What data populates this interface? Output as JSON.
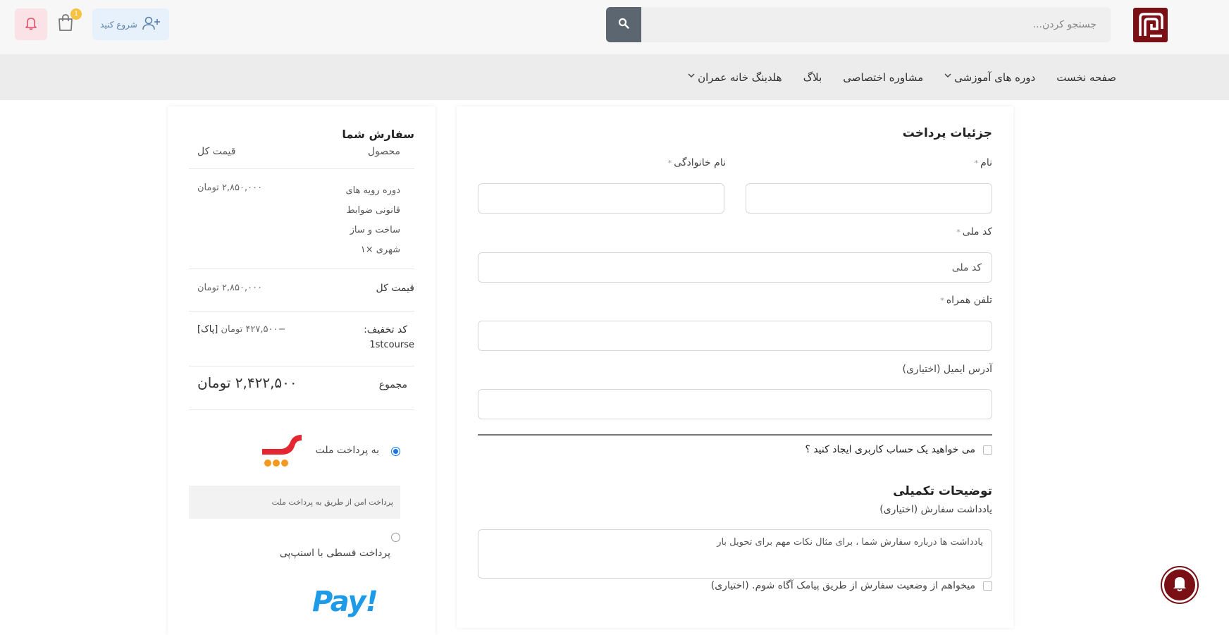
{
  "header": {
    "logo_icon": "brand-logo-icon",
    "search_placeholder": "جستجو کردن...",
    "login_label": "شروع کنید",
    "cart_count": "1",
    "colors": {
      "brand": "#7a1016",
      "search_button": "#5c6670",
      "login_bg": "#e6f1fb",
      "bell_bg": "#fbe2e6",
      "badge": "#f5c242"
    }
  },
  "nav": {
    "items": [
      {
        "label": "صفحه نخست",
        "dropdown": false
      },
      {
        "label": "دوره های آموزشی",
        "dropdown": true
      },
      {
        "label": "مشاوره اختصاصی",
        "dropdown": false
      },
      {
        "label": "بلاگ",
        "dropdown": false
      },
      {
        "label": "هلدینگ خانه عمران",
        "dropdown": true
      }
    ]
  },
  "billing": {
    "title": "جزئیات پرداخت",
    "first_name_label": "نام",
    "last_name_label": "نام خانوادگی",
    "required_mark": "*",
    "national_code_label": "کد ملی",
    "national_code_placeholder": "کد ملی",
    "mobile_label": "تلفن همراه",
    "email_label": "آدرس ایمیل (اختیاری)",
    "create_account_label": "می خواهید یک حساب کاربری ایجاد کنید ؟",
    "additional_title": "توضیحات تکمیلی",
    "order_note_label": "یادداشت سفارش (اختیاری)",
    "order_note_placeholder": "یادداشت ها درباره سفارش شما ، برای مثال نکات مهم برای تحویل بار",
    "sms_label": "میخواهم از وضعیت سفارش از طریق پیامک آگاه شوم. (اختیاری)"
  },
  "order": {
    "title": "سفارش شما",
    "col_product": "محصول",
    "col_total": "قیمت کل",
    "product_lines": [
      "دوره رویه های",
      "قانونی ضوابط",
      "ساخت و ساز",
      "شهری  ×۱"
    ],
    "product_price": "۲,۸۵۰,۰۰۰ تومان",
    "subtotal_label": "قیمت کل",
    "subtotal_value": "۲,۸۵۰,۰۰۰ تومان",
    "coupon_label": "کد تخفیف:",
    "coupon_code": "1stcourse",
    "coupon_value": "−۴۲۷,۵۰۰ تومان",
    "coupon_remove": "[پاک]",
    "total_label": "مجموع",
    "total_value": "۲,۴۲۲,۵۰۰ تومان",
    "payment_mellat_label": "به پرداخت ملت",
    "payment_mellat_desc": "پرداخت امن از طریق به پرداخت ملت",
    "payment_snapp_label": "پرداخت قسطی با اسنپ‌پی",
    "snapp_logo_text": "Pay!"
  }
}
